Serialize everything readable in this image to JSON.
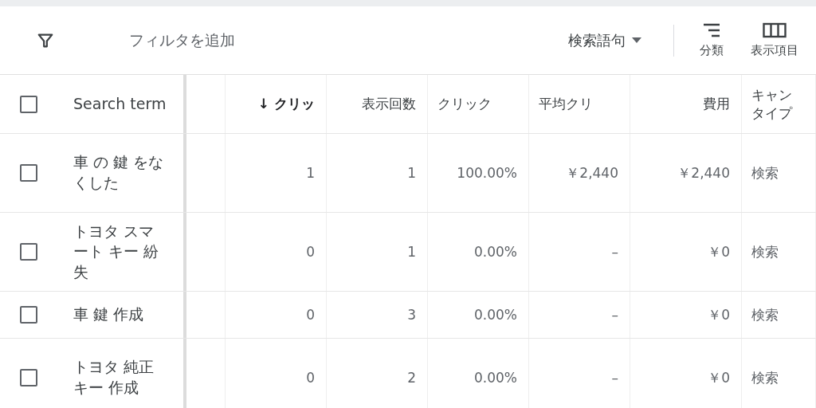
{
  "toolbar": {
    "filter_placeholder": "フィルタを追加",
    "dropdown": "検索語句",
    "actions": [
      {
        "kind": "segment",
        "label": "分類"
      },
      {
        "kind": "columns",
        "label": "表示項目"
      }
    ]
  },
  "table": {
    "select_all": {
      "checked": false
    },
    "columns": [
      {
        "label": "Search term",
        "sorted": false
      },
      {
        "label": "↓ クリッ",
        "sorted": true
      },
      {
        "label": "表示回数",
        "sorted": false
      },
      {
        "label": "クリック",
        "sorted": false
      },
      {
        "label": "平均クリ",
        "sorted": false
      },
      {
        "label": "費用",
        "sorted": false
      },
      {
        "label": "キャンタイプ",
        "sorted": false
      }
    ],
    "rows": [
      {
        "checked": false,
        "term": "車 の 鍵 をなくした",
        "clicks": "1",
        "impressions": "1",
        "ctr": "100.00%",
        "avg_cpc": "￥2,440",
        "cost": "￥2,440",
        "type": "検索"
      },
      {
        "checked": false,
        "term": "トヨタ スマート キー 紛失",
        "clicks": "0",
        "impressions": "1",
        "ctr": "0.00%",
        "avg_cpc": "–",
        "cost": "￥0",
        "type": "検索"
      },
      {
        "checked": false,
        "term": "車 鍵 作成",
        "clicks": "0",
        "impressions": "3",
        "ctr": "0.00%",
        "avg_cpc": "–",
        "cost": "￥0",
        "type": "検索"
      },
      {
        "checked": false,
        "term": "トヨタ 純正キー 作成",
        "clicks": "0",
        "impressions": "2",
        "ctr": "0.00%",
        "avg_cpc": "–",
        "cost": "￥0",
        "type": "検索"
      }
    ]
  }
}
